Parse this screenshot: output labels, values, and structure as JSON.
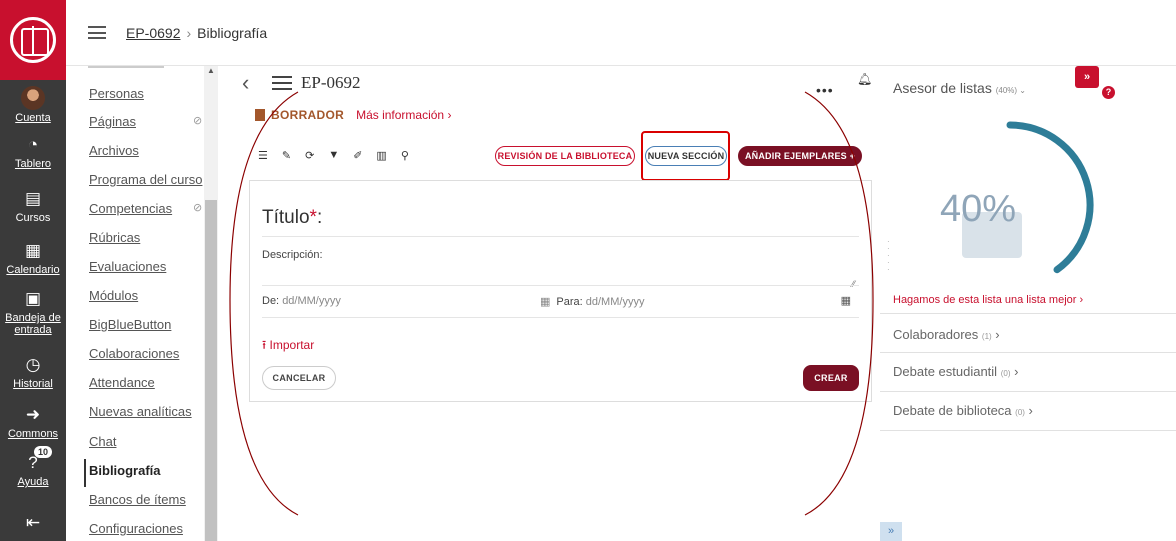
{
  "global_nav": {
    "items": [
      {
        "icon": "avatar",
        "label": "Cuenta"
      },
      {
        "icon": "dashboard-icon",
        "label": "Tablero"
      },
      {
        "icon": "book-icon",
        "label": "Cursos"
      },
      {
        "icon": "calendar-icon",
        "label": "Calendario"
      },
      {
        "icon": "inbox-icon",
        "label": "Bandeja de entrada"
      },
      {
        "icon": "clock-icon",
        "label": "Historial"
      },
      {
        "icon": "commons-icon",
        "label": "Commons"
      },
      {
        "icon": "help-icon",
        "label": "Ayuda",
        "badge": "10"
      }
    ]
  },
  "breadcrumb": {
    "course": "EP-0692",
    "separator": "›",
    "page": "Bibliografía"
  },
  "course_nav": {
    "items": [
      "Personas",
      "Páginas",
      "Archivos",
      "Programa del curso",
      "Competencias",
      "Rúbricas",
      "Evaluaciones",
      "Módulos",
      "BigBlueButton",
      "Colaboraciones",
      "Attendance",
      "Nuevas analíticas",
      "Chat",
      "Bibliografía",
      "Bancos de ítems",
      "Configuraciones"
    ],
    "active": "Bibliografía"
  },
  "list": {
    "title": "EP-0692",
    "status": "BORRADOR",
    "more_info": "Más información ›",
    "more": "•••",
    "buttons": {
      "review": "REVISIÓN DE LA BIBLIOTECA",
      "new_section": "NUEVA SECCIÓN",
      "add_items": "AÑADIR EJEMPLARES  +"
    }
  },
  "form": {
    "title_label": "Título",
    "required_mark": "*",
    "title_colon": ":",
    "description_label": "Descripción:",
    "from_label": "De:",
    "from_placeholder": "dd/MM/yyyy",
    "to_label": "Para:",
    "to_placeholder": "dd/MM/yyyy",
    "import_label": "Importar",
    "cancel_label": "CANCELAR",
    "create_label": "CREAR"
  },
  "advisor": {
    "title": "Asesor de listas",
    "title_pct": "(40%)",
    "percent": "40%",
    "progress": 0.4,
    "better_link": "Hagamos de esta lista una lista mejor ›",
    "sections": [
      {
        "label": "Colaboradores",
        "count": "(1)"
      },
      {
        "label": "Debate estudiantil",
        "count": "(0)"
      },
      {
        "label": "Debate de biblioteca",
        "count": "(0)"
      }
    ]
  },
  "colors": {
    "accent": "#c8102e",
    "dark_accent": "#7a1024",
    "arc": "#2e7d98",
    "annotation": "#8b0000"
  }
}
